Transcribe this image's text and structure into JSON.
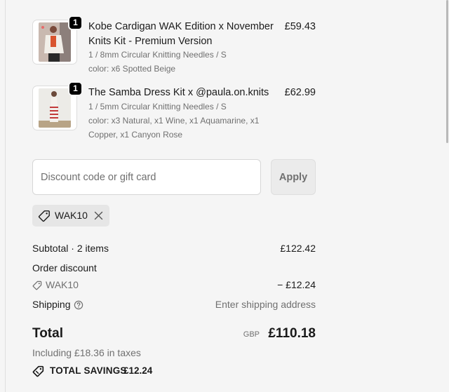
{
  "line_items": [
    {
      "quantity": "1",
      "title": "Kobe Cardigan WAK Edition x November Knits Kit - Premium Version",
      "price": "£59.43",
      "options": [
        "1 / 8mm Circular Knitting Needles / S",
        "color: x6 Spotted Beige"
      ]
    },
    {
      "quantity": "1",
      "title": "The Samba Dress Kit x @paula.on.knits",
      "price": "£62.99",
      "options": [
        "1 / 5mm Circular Knitting Needles / S",
        "color: x3 Natural, x1 Wine, x1 Aquamarine, x1",
        "Copper, x1 Canyon Rose"
      ]
    }
  ],
  "discount": {
    "placeholder": "Discount code or gift card",
    "value": "",
    "apply_label": "Apply",
    "applied_code": "WAK10"
  },
  "summary": {
    "subtotal_label": "Subtotal · 2 items",
    "subtotal_value": "£122.42",
    "order_discount_label": "Order discount",
    "discount_code": "WAK10",
    "discount_value": "− £12.24",
    "shipping_label": "Shipping",
    "shipping_value": "Enter shipping address",
    "total_label": "Total",
    "currency": "GBP",
    "total_value": "£110.18",
    "taxes_note": "Including £18.36 in taxes",
    "savings_label": "TOTAL SAVINGS",
    "savings_value": "£12.24"
  }
}
